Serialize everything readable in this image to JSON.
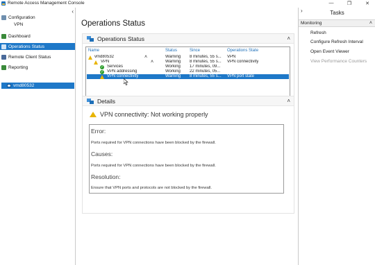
{
  "window": {
    "title": "Remote Access Management Console",
    "minimize": "—",
    "restore": "❐",
    "close": "✕"
  },
  "nav": {
    "collapse": "‹",
    "items": [
      {
        "label": "Configuration"
      },
      {
        "label": "VPN"
      },
      {
        "label": "Dashboard"
      },
      {
        "label": "Operations Status"
      },
      {
        "label": "Remote Client Status"
      },
      {
        "label": "Reporting"
      }
    ],
    "server": "vmd80532"
  },
  "main": {
    "page_title": "Operations Status",
    "ops_panel": {
      "title": "Operations Status",
      "caret": "˄"
    },
    "table": {
      "headers": [
        "Name",
        "Status",
        "Since",
        "Operations State"
      ],
      "rows": [
        {
          "name": "vmd80532",
          "status": "Warning",
          "since": "8 minutes, 55 s...",
          "state": "VPN",
          "icon": "warning",
          "expanded": true
        },
        {
          "name": "VPN",
          "status": "Warning",
          "since": "8 minutes, 55 s...",
          "state": "VPN connectivity",
          "icon": "warning",
          "expanded": true
        },
        {
          "name": "Services",
          "status": "Working",
          "since": "17 minutes, 09...",
          "state": "",
          "icon": "ok"
        },
        {
          "name": "VPN addressing",
          "status": "Working",
          "since": "22 minutes, 05...",
          "state": "",
          "icon": "ok"
        },
        {
          "name": "VPN connectivity",
          "status": "Warning",
          "since": "8 minutes, 55 s...",
          "state": "VPN port state",
          "icon": "warning",
          "selected": true
        }
      ]
    },
    "details_panel": {
      "title": "Details",
      "caret": "˄"
    },
    "details": {
      "message": "VPN connectivity: Not working properly",
      "error_heading": "Error:",
      "error_text": "Ports required for VPN connections have been blocked by the firewall.",
      "causes_heading": "Causes:",
      "causes_text": "Ports required for VPN connections have been blocked by the firewall.",
      "resolution_heading": "Resolution:",
      "resolution_text": "Ensure that VPN ports and protocols are not blocked by the firewall."
    }
  },
  "tasks": {
    "collapse": "›",
    "title": "Tasks",
    "group": "Monitoring",
    "group_caret": "˄",
    "items": [
      {
        "label": "Refresh",
        "enabled": true
      },
      {
        "label": "Configure Refresh Interval",
        "enabled": true
      },
      {
        "label": "Open Event Viewer",
        "enabled": true
      },
      {
        "label": "View Performance Counters",
        "enabled": false
      }
    ]
  },
  "colors": {
    "accent": "#1e78c8",
    "warning": "#e8b400",
    "ok": "#2e9e2e",
    "header_text": "#1e6fb8"
  }
}
